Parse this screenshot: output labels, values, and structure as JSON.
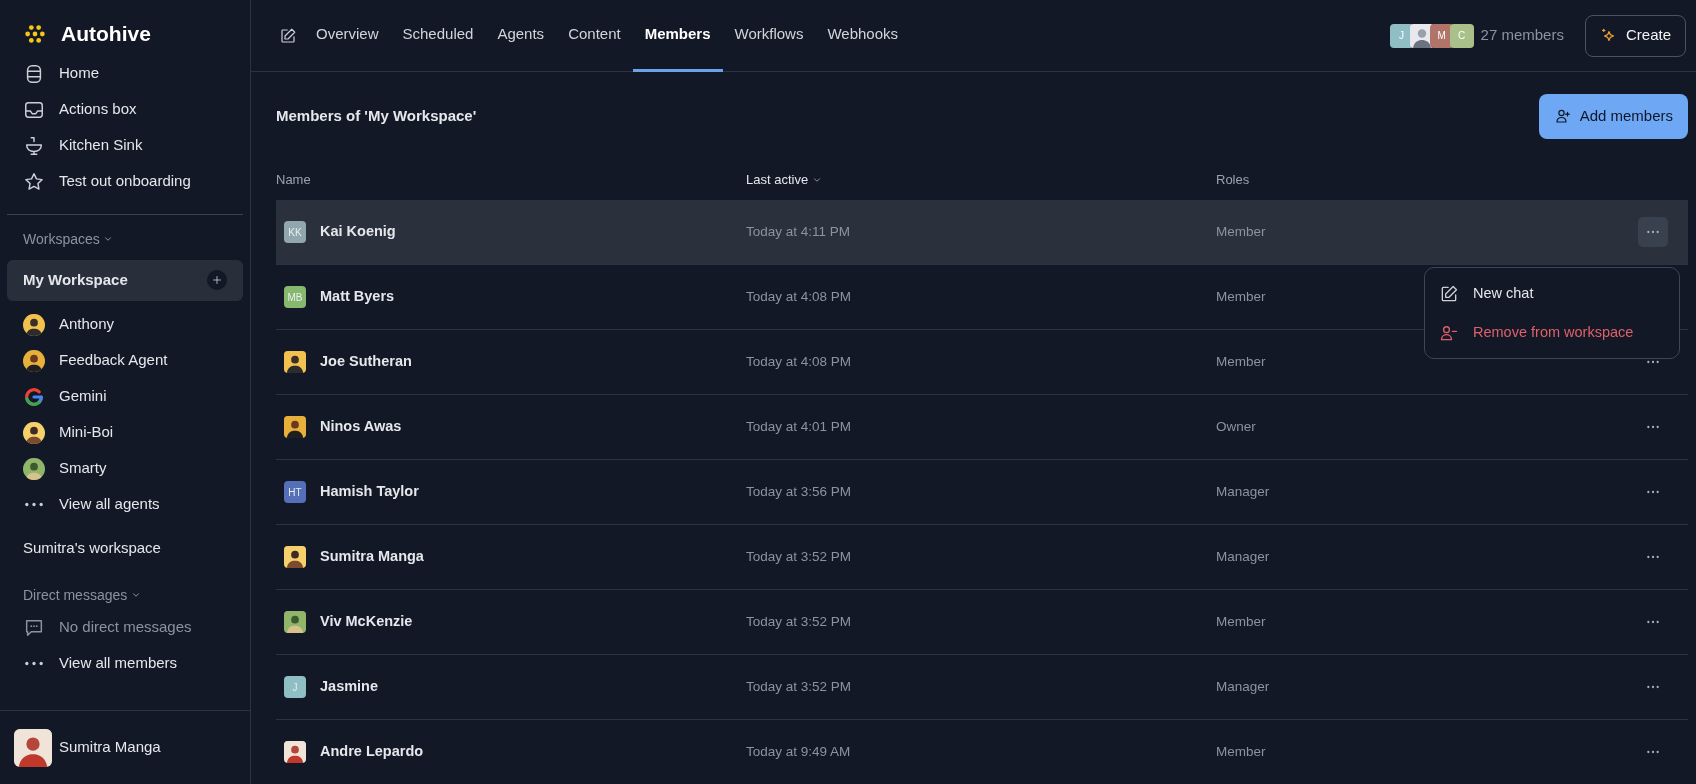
{
  "sidebar": {
    "brand": "Autohive",
    "nav": [
      {
        "label": "Home",
        "kind": "home"
      },
      {
        "label": "Actions box",
        "kind": "inbox"
      },
      {
        "label": "Kitchen Sink",
        "kind": "sink"
      },
      {
        "label": "Test out onboarding",
        "kind": "star"
      }
    ],
    "workspaces_heading": "Workspaces",
    "current_workspace": {
      "name": "My Workspace",
      "selected": true
    },
    "agents": [
      {
        "name": "Anthony",
        "kind": "picture"
      },
      {
        "name": "Feedback Agent",
        "kind": "picture"
      },
      {
        "name": "Gemini",
        "kind": "logo"
      },
      {
        "name": "Mini-Boi",
        "kind": "picture"
      },
      {
        "name": "Smarty",
        "kind": "picture"
      }
    ],
    "view_all_agents": "View all agents",
    "other_workspace": "Sumitra's workspace",
    "dm_heading": "Direct messages",
    "dm_empty": "No direct messages",
    "view_all_members": "View all members",
    "user": {
      "name": "Sumitra Manga"
    }
  },
  "tabs": [
    {
      "label": "Overview",
      "selected": false
    },
    {
      "label": "Scheduled",
      "selected": false
    },
    {
      "label": "Agents",
      "selected": false
    },
    {
      "label": "Content",
      "selected": false
    },
    {
      "label": "Members",
      "selected": true
    },
    {
      "label": "Workflows",
      "selected": false
    },
    {
      "label": "Webhooks",
      "selected": false
    }
  ],
  "member_stack": [
    {
      "initials": "J",
      "color": "#8fbfc4"
    },
    {
      "kind": "picture"
    },
    {
      "initials": "M",
      "color": "#b07468"
    },
    {
      "initials": "C",
      "color": "#a9c08a"
    }
  ],
  "member_count": "27 members",
  "create_button": "Create",
  "title": "Members of 'My Workspace'",
  "add_button": "Add members",
  "columns": [
    {
      "label": "Name",
      "sorted": false
    },
    {
      "label": "Last active",
      "sorted": true
    },
    {
      "label": "Roles",
      "sorted": false
    }
  ],
  "rows": [
    {
      "name": "Kai Koenig",
      "initials": "KK",
      "color": "#90a8ad",
      "last_active": "Today at 4:11 PM",
      "role": "Member",
      "selected": true
    },
    {
      "name": "Matt Byers",
      "initials": "MB",
      "color": "#86b86e",
      "last_active": "Today at 4:08 PM",
      "role": "Member",
      "selected": false
    },
    {
      "name": "Joe Sutheran",
      "kind": "picture",
      "last_active": "Today at 4:08 PM",
      "role": "Member",
      "selected": false
    },
    {
      "name": "Ninos Awas",
      "kind": "picture",
      "last_active": "Today at 4:01 PM",
      "role": "Owner",
      "selected": false
    },
    {
      "name": "Hamish Taylor",
      "initials": "HT",
      "color": "#5570b8",
      "last_active": "Today at 3:56 PM",
      "role": "Manager",
      "selected": false
    },
    {
      "name": "Sumitra Manga",
      "kind": "picture",
      "last_active": "Today at 3:52 PM",
      "role": "Manager",
      "selected": false
    },
    {
      "name": "Viv McKenzie",
      "kind": "picture",
      "last_active": "Today at 3:52 PM",
      "role": "Member",
      "selected": false
    },
    {
      "name": "Jasmine",
      "initials": "J",
      "color": "#8fbfc4",
      "last_active": "Today at 3:52 PM",
      "role": "Manager",
      "selected": false
    },
    {
      "name": "Andre Lepardo",
      "kind": "picture",
      "last_active": "Today at 9:49 AM",
      "role": "Member",
      "selected": false
    }
  ],
  "row_menu": {
    "items": [
      {
        "label": "New chat",
        "kind": "chat"
      },
      {
        "label": "Remove from workspace",
        "kind": "danger"
      }
    ]
  }
}
